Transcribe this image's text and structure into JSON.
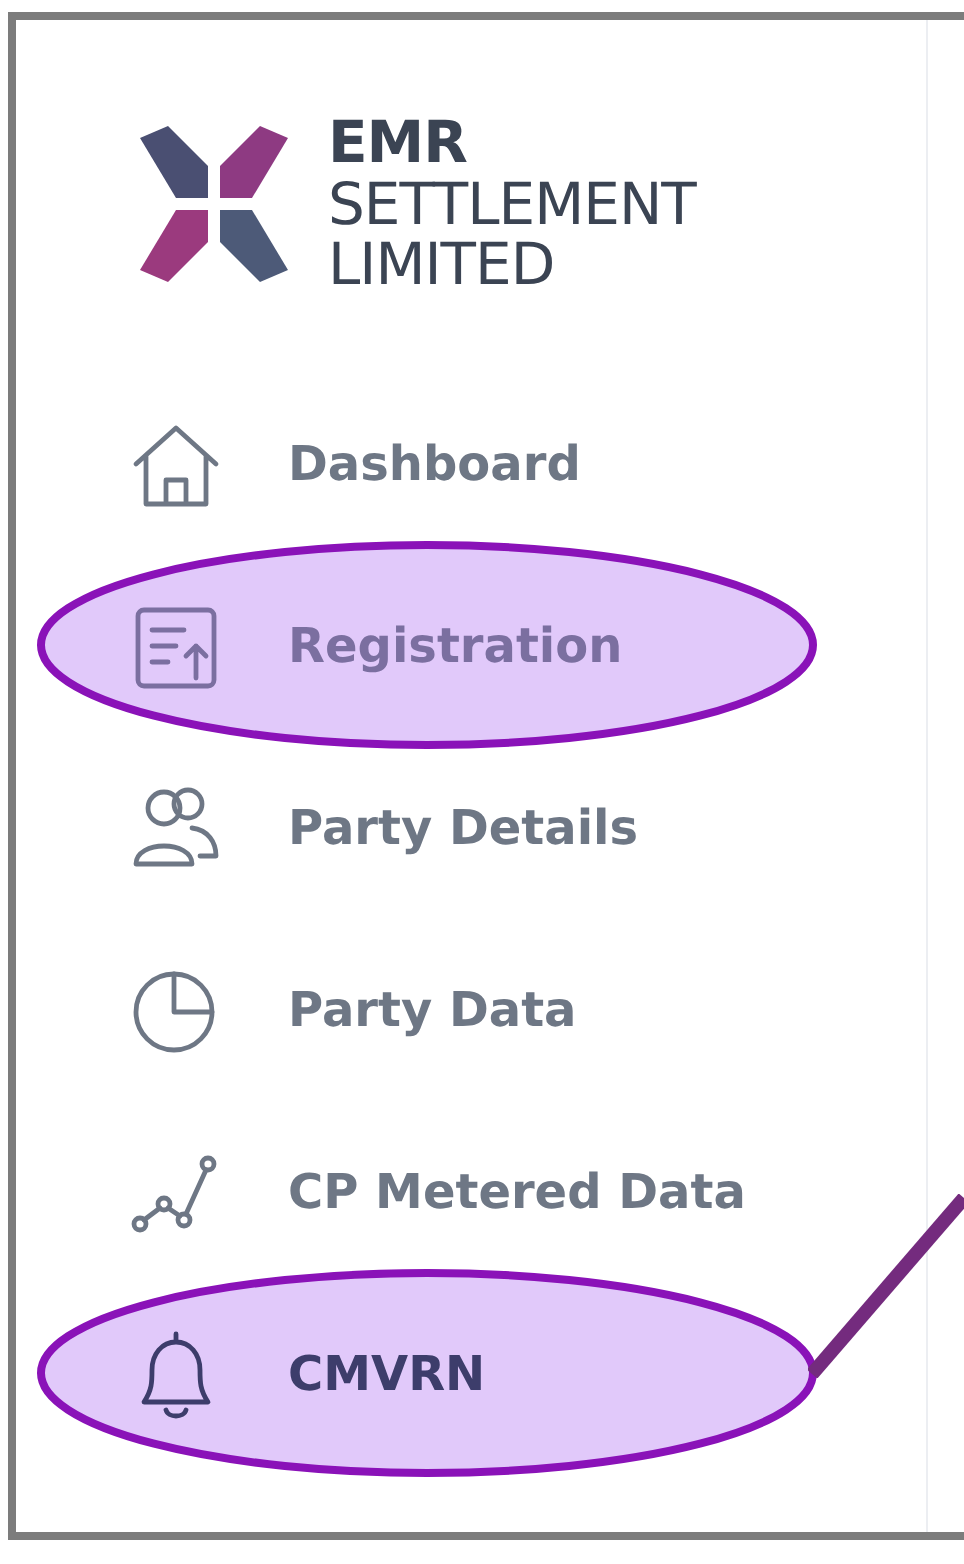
{
  "logo": {
    "lines": [
      "EMR",
      "SETTLEMENT",
      "LIMITED"
    ]
  },
  "items": [
    {
      "kind": "home",
      "label": "Dashboard",
      "selected": false,
      "highlighted": false,
      "callout": false
    },
    {
      "kind": "upload",
      "label": "Registration",
      "selected": false,
      "highlighted": true,
      "callout": false
    },
    {
      "kind": "people",
      "label": "Party Details",
      "selected": false,
      "highlighted": false,
      "callout": false
    },
    {
      "kind": "pie",
      "label": "Party Data",
      "selected": false,
      "highlighted": false,
      "callout": false
    },
    {
      "kind": "graph",
      "label": "CP Metered Data",
      "selected": false,
      "highlighted": false,
      "callout": false
    },
    {
      "kind": "bell",
      "label": "CMVRN",
      "selected": true,
      "highlighted": true,
      "callout": true
    }
  ]
}
